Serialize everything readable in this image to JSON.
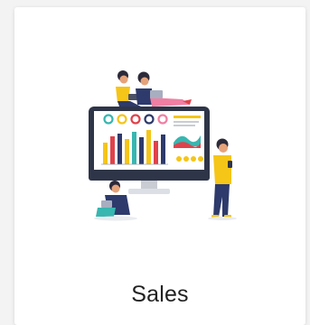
{
  "card": {
    "title": "Sales",
    "illustration": "sales-dashboard-illustration"
  },
  "colors": {
    "page_bg": "#f3f3f3",
    "card_bg": "#ffffff",
    "title": "#222222",
    "accent_yellow": "#f5c518",
    "accent_navy": "#2d3a6b",
    "accent_teal": "#38b6b0",
    "accent_red": "#e0424b",
    "accent_pink": "#f07fa3"
  }
}
